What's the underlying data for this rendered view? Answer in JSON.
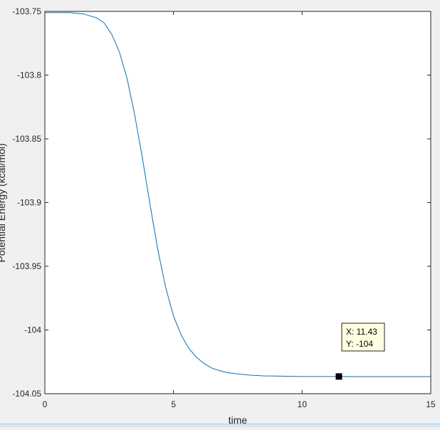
{
  "chart_data": {
    "type": "line",
    "title": "",
    "xlabel": "time",
    "ylabel": "Potential Energy (kcal/mol)",
    "xlim": [
      0,
      15
    ],
    "ylim": [
      -104.05,
      -103.75
    ],
    "xticks": [
      0,
      5,
      10,
      15
    ],
    "xtick_labels": [
      "0",
      "5",
      "10",
      "15"
    ],
    "yticks": [
      -103.75,
      -103.8,
      -103.85,
      -103.9,
      -103.95,
      -104,
      -104.05
    ],
    "ytick_labels": [
      "-103.75",
      "-103.8",
      "-103.85",
      "-103.9",
      "-103.95",
      "-104",
      "-104.05"
    ],
    "grid": false,
    "series": [
      {
        "color": "#0072bd",
        "x": [
          0,
          1,
          1.5,
          2,
          2.3,
          2.6,
          2.9,
          3.2,
          3.5,
          3.8,
          4.1,
          4.4,
          4.7,
          5.0,
          5.3,
          5.6,
          5.9,
          6.2,
          6.5,
          6.8,
          7.1,
          7.5,
          8,
          8.5,
          9,
          10,
          11,
          11.43,
          12,
          13,
          14,
          15
        ],
        "y": [
          -103.751,
          -103.751,
          -103.752,
          -103.755,
          -103.759,
          -103.768,
          -103.782,
          -103.803,
          -103.832,
          -103.866,
          -103.903,
          -103.938,
          -103.967,
          -103.989,
          -104.004,
          -104.0145,
          -104.0215,
          -104.0265,
          -104.03,
          -104.032,
          -104.0335,
          -104.0345,
          -104.0355,
          -104.036,
          -104.0362,
          -104.0365,
          -104.0365,
          -104.0365,
          -104.0366,
          -104.0366,
          -104.0366,
          -104.0366
        ]
      }
    ],
    "datatip": {
      "x": 11.43,
      "y": -104.0365,
      "line1": "X: 11.43",
      "line2": "Y: -104"
    }
  }
}
